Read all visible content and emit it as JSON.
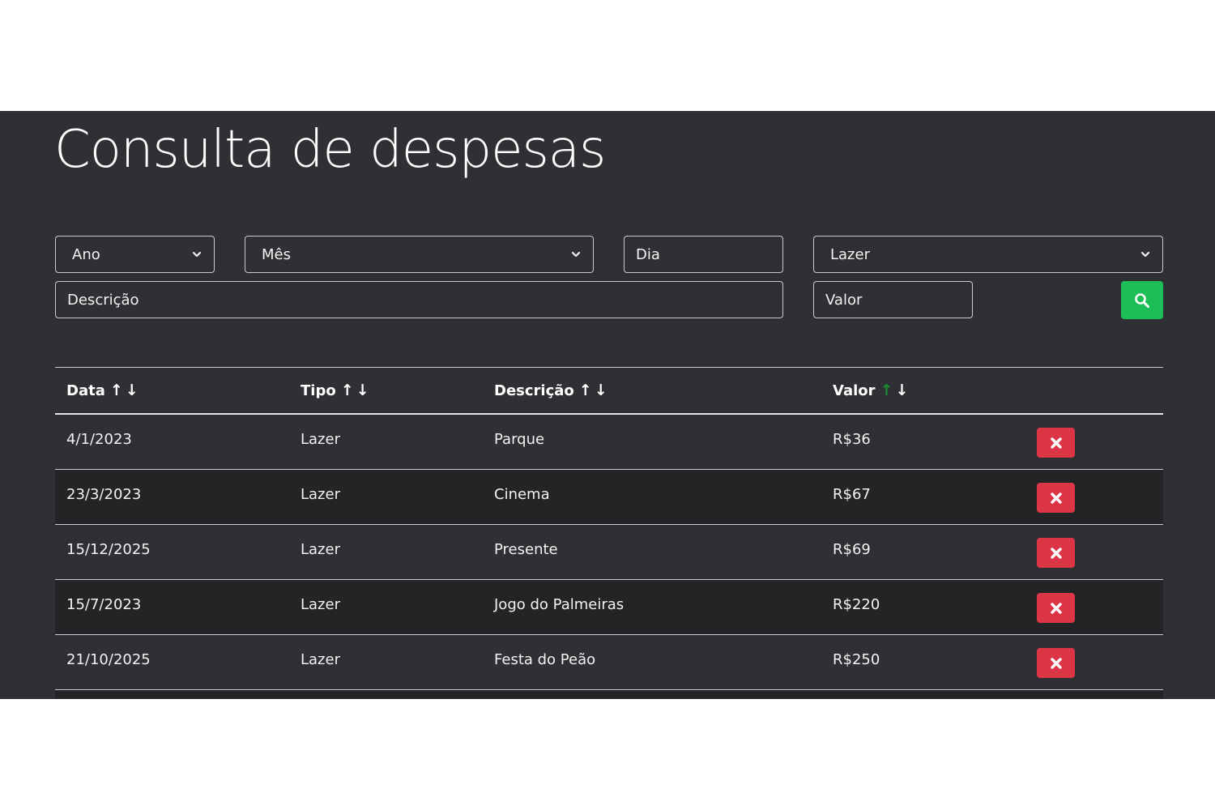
{
  "page": {
    "title": "Consulta de despesas"
  },
  "filters": {
    "ano": "Ano",
    "mes": "Mês",
    "dia_placeholder": "Dia",
    "tipo": "Lazer",
    "descricao_placeholder": "Descrição",
    "valor_placeholder": "Valor",
    "search_icon": "search-icon"
  },
  "table": {
    "headers": [
      {
        "label": "Data",
        "up": "↑",
        "down": "↓"
      },
      {
        "label": "Tipo",
        "up": "↑",
        "down": "↓"
      },
      {
        "label": "Descrição",
        "up": "↑",
        "down": "↓"
      },
      {
        "label": "Valor",
        "up": "↑",
        "down": "↓"
      }
    ],
    "active_sort": {
      "column": "Valor",
      "direction": "up",
      "color": "#1a8a2e"
    },
    "rows": [
      {
        "data": "4/1/2023",
        "tipo": "Lazer",
        "descricao": "Parque",
        "valor": "R$36"
      },
      {
        "data": "23/3/2023",
        "tipo": "Lazer",
        "descricao": "Cinema",
        "valor": "R$67"
      },
      {
        "data": "15/12/2025",
        "tipo": "Lazer",
        "descricao": "Presente",
        "valor": "R$69"
      },
      {
        "data": "15/7/2023",
        "tipo": "Lazer",
        "descricao": "Jogo do Palmeiras",
        "valor": "R$220"
      },
      {
        "data": "21/10/2025",
        "tipo": "Lazer",
        "descricao": "Festa do Peão",
        "valor": "R$250"
      }
    ],
    "delete_icon": "close-icon"
  },
  "colors": {
    "background": "#2f3033",
    "search_button": "#1dbe57",
    "delete_button": "#dc3545"
  }
}
